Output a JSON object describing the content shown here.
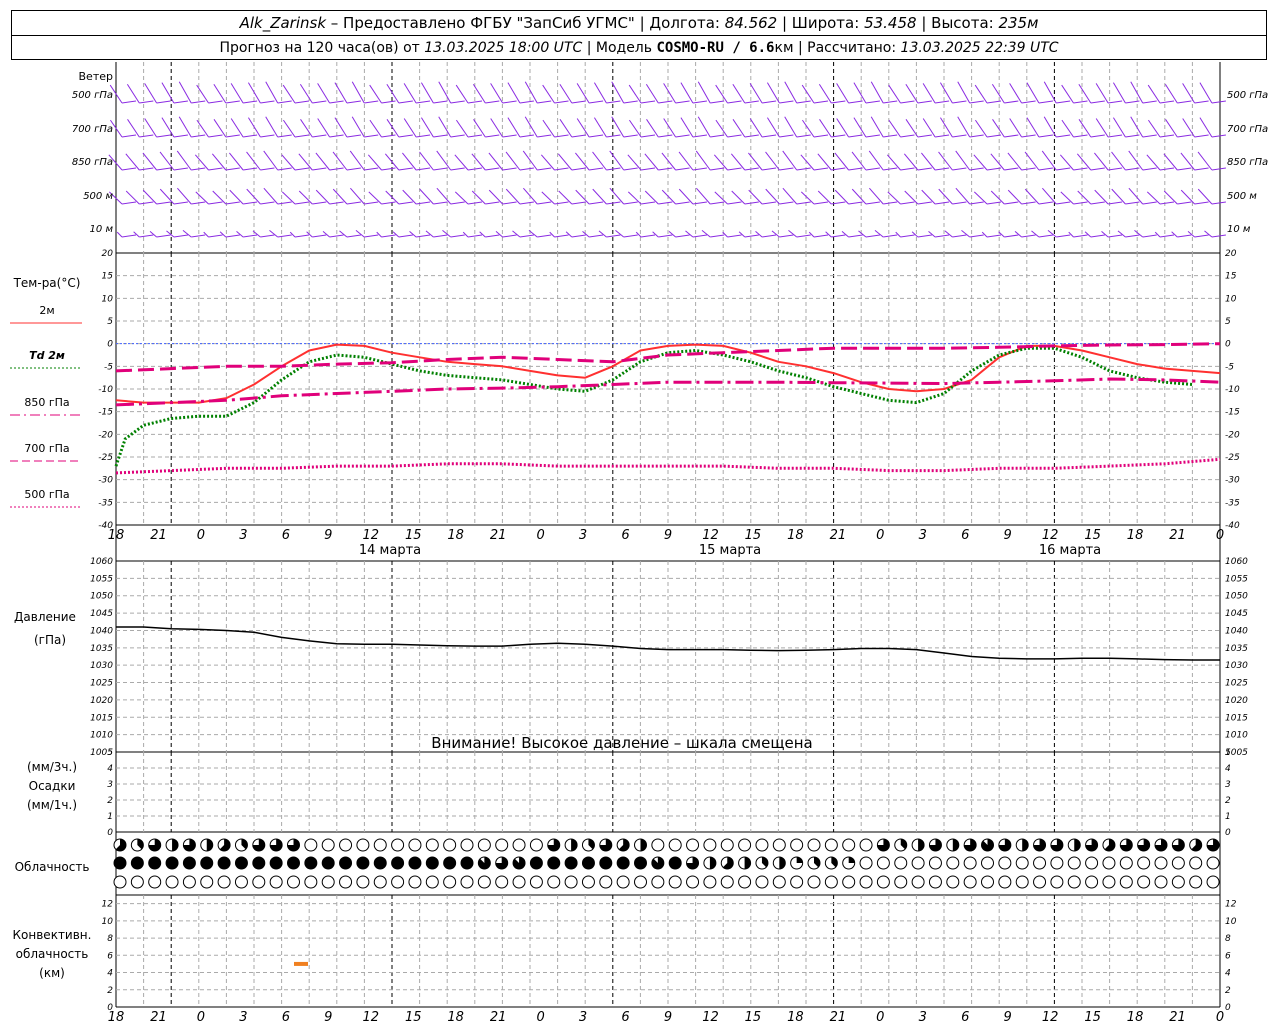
{
  "header": {
    "station": "Alk_Zarinsk",
    "provided": " – Предоставлено ФГБУ \"ЗапСиб УГМС\" | Долгота: ",
    "lon": "84.562",
    "lat_label": " | Широта: ",
    "lat": "53.458",
    "alt_label": " | Высота: ",
    "alt": "235м",
    "forecast_label": "Прогноз на 120 часа(ов) от ",
    "forecast_from": "13.03.2025 18:00 UTC",
    "model_label": " | Модель ",
    "model": "COSMO-RU / 6.6",
    "model_unit": "км",
    "calc_label": " | Рассчитано: ",
    "calc_time": "13.03.2025 22:39 UTC"
  },
  "x_ticks": [
    "18",
    "21",
    "0",
    "3",
    "6",
    "9",
    "12",
    "15",
    "18",
    "21",
    "0",
    "3",
    "6",
    "9",
    "12",
    "15",
    "18",
    "21",
    "0",
    "3",
    "6",
    "9",
    "12",
    "15",
    "18",
    "21",
    "0"
  ],
  "day_labels": [
    "14 марта",
    "15 марта",
    "16 марта"
  ],
  "wind_panel": {
    "title": "Ветер",
    "levels": [
      "500 гПа",
      "700 гПа",
      "850 гПа",
      "500 м",
      "10  м"
    ]
  },
  "temp_panel": {
    "title": "Тем-ра(°C)",
    "y_ticks": [
      20,
      15,
      10,
      5,
      0,
      -5,
      -10,
      -15,
      -20,
      -25,
      -30,
      -35,
      -40
    ],
    "legend": [
      {
        "label": "2м",
        "color": "#ff3030",
        "style": "solid"
      },
      {
        "label": "Td  2м",
        "color": "#008000",
        "style": "dotted"
      },
      {
        "label": "850 гПа",
        "color": "#e0007a",
        "style": "dashdot"
      },
      {
        "label": "700 гПа",
        "color": "#e0007a",
        "style": "dash"
      },
      {
        "label": "500 гПа",
        "color": "#e0007a",
        "style": "dotfine"
      }
    ]
  },
  "pressure_panel": {
    "title": "Давление",
    "unit": "(гПа)",
    "y_ticks": [
      1060,
      1055,
      1050,
      1045,
      1040,
      1035,
      1030,
      1025,
      1020,
      1015,
      1010,
      1005
    ],
    "warning": "Внимание! Высокое давление – шкала смещена"
  },
  "precip_panel": {
    "title_top": "(мм/3ч.)",
    "title_mid": "Осадки",
    "title_bot": "(мм/1ч.)",
    "y_ticks": [
      5,
      4,
      3,
      2,
      1,
      0
    ]
  },
  "cloud_panel": {
    "title": "Облачность"
  },
  "conv_panel": {
    "title1": "Конвективн.",
    "title2": "облачность",
    "title3": "(км)",
    "y_ticks": [
      12,
      10,
      8,
      6,
      4,
      2,
      0
    ],
    "color": "#f08020"
  },
  "chart_data": {
    "type": "line",
    "x_unit": "hours since 13.03.2025 18:00 UTC",
    "temperature": {
      "ylim": [
        -40,
        20
      ],
      "series": [
        {
          "name": "2м",
          "x": [
            0,
            3,
            6,
            9,
            12,
            15,
            18,
            21,
            24,
            27,
            30,
            33,
            36,
            39,
            42,
            45,
            48,
            51,
            54,
            57,
            60,
            63,
            66,
            69,
            72,
            75,
            78,
            81,
            84,
            87,
            90,
            93,
            96,
            99,
            102,
            105,
            108,
            111,
            114,
            117,
            120
          ],
          "values": [
            -12.5,
            -13,
            -13,
            -13,
            -12,
            -9,
            -5,
            -1.5,
            -0.2,
            -0.5,
            -2,
            -3,
            -4,
            -4.5,
            -5,
            -6,
            -7,
            -7.5,
            -5,
            -1.5,
            -0.5,
            -0.2,
            -0.5,
            -2,
            -4,
            -5,
            -6.5,
            -8.5,
            -10,
            -10.5,
            -10,
            -8,
            -3,
            -0.5,
            -0.5,
            -1.5,
            -3,
            -4.5,
            -5.5,
            -6,
            -6.5
          ]
        },
        {
          "name": "Td  2м",
          "x": [
            0,
            1,
            3,
            6,
            9,
            12,
            15,
            18,
            21,
            24,
            27,
            30,
            33,
            36,
            39,
            42,
            45,
            48,
            51,
            54,
            57,
            60,
            63,
            66,
            69,
            72,
            75,
            78,
            81,
            84,
            87,
            90,
            93,
            96,
            99,
            102,
            105,
            108,
            111,
            114,
            117,
            120
          ],
          "values": [
            -27,
            -21,
            -18,
            -16.5,
            -16,
            -16,
            -13,
            -8,
            -4,
            -2.5,
            -3,
            -4.5,
            -6,
            -7,
            -7.5,
            -8,
            -9,
            -10,
            -10.5,
            -8,
            -4,
            -2,
            -1.5,
            -2.5,
            -4,
            -6,
            -7.5,
            -9.5,
            -11,
            -12.5,
            -13,
            -11,
            -6,
            -2.5,
            -1,
            -1,
            -3,
            -6,
            -7.5,
            -8.5,
            -9
          ]
        },
        {
          "name": "850 гПа",
          "x": [
            0,
            6,
            12,
            18,
            24,
            30,
            36,
            42,
            48,
            54,
            60,
            66,
            72,
            78,
            84,
            90,
            96,
            102,
            108,
            114,
            120
          ],
          "values": [
            -13.5,
            -13,
            -12.5,
            -11.5,
            -11,
            -10.5,
            -10,
            -9.8,
            -9.5,
            -9,
            -8.5,
            -8.5,
            -8.5,
            -8.6,
            -8.7,
            -8.8,
            -8.5,
            -8.2,
            -7.8,
            -8,
            -8.5
          ]
        },
        {
          "name": "700 гПа",
          "x": [
            0,
            6,
            12,
            18,
            24,
            30,
            36,
            42,
            48,
            54,
            60,
            66,
            72,
            78,
            84,
            90,
            96,
            102,
            108,
            114,
            120
          ],
          "values": [
            -6,
            -5.5,
            -5,
            -5,
            -4.5,
            -4.2,
            -3.5,
            -3,
            -3.5,
            -4,
            -2.5,
            -2,
            -1.5,
            -1,
            -1,
            -1,
            -0.8,
            -0.5,
            -0.3,
            -0.2,
            0
          ]
        },
        {
          "name": "500 гПа",
          "x": [
            0,
            6,
            12,
            18,
            24,
            30,
            36,
            42,
            48,
            54,
            60,
            66,
            72,
            78,
            84,
            90,
            96,
            102,
            108,
            114,
            120
          ],
          "values": [
            -28.5,
            -28,
            -27.5,
            -27.5,
            -27,
            -27,
            -26.5,
            -26.5,
            -27,
            -27,
            -27,
            -27,
            -27.5,
            -27.5,
            -28,
            -28,
            -27.5,
            -27.5,
            -27,
            -26.5,
            -25.5
          ]
        }
      ]
    },
    "pressure": {
      "ylim": [
        1005,
        1060
      ],
      "series": [
        {
          "name": "Давление",
          "x": [
            0,
            3,
            6,
            9,
            12,
            15,
            18,
            21,
            24,
            27,
            30,
            33,
            36,
            39,
            42,
            45,
            48,
            51,
            54,
            57,
            60,
            63,
            66,
            69,
            72,
            75,
            78,
            81,
            84,
            87,
            90,
            93,
            96,
            99,
            102,
            105,
            108,
            111,
            114,
            117,
            120
          ],
          "values": [
            1041,
            1041,
            1040.5,
            1040.3,
            1040,
            1039.5,
            1038,
            1037,
            1036.2,
            1036,
            1036,
            1035.8,
            1035.6,
            1035.5,
            1035.5,
            1036,
            1036.3,
            1036,
            1035.5,
            1034.8,
            1034.5,
            1034.5,
            1034.5,
            1034.3,
            1034.2,
            1034.3,
            1034.5,
            1034.8,
            1034.8,
            1034.5,
            1033.5,
            1032.5,
            1032,
            1031.8,
            1031.8,
            1032,
            1032,
            1031.8,
            1031.6,
            1031.5,
            1031.5
          ]
        }
      ]
    },
    "precipitation": {
      "ylim": [
        0,
        5
      ],
      "values_mm_per_3h": []
    },
    "convective_cloud": {
      "ylim": [
        0,
        13
      ],
      "bars": [
        {
          "x": 20,
          "height_km": 5
        }
      ]
    },
    "cloud_cover_eighths": {
      "low": [
        0,
        0,
        0,
        0,
        0,
        0,
        0,
        0,
        0,
        0,
        0,
        0,
        0,
        0,
        0,
        0,
        0,
        0,
        0,
        0,
        0,
        0,
        0,
        0,
        0,
        0,
        0,
        0,
        0,
        0,
        0,
        0,
        0,
        0,
        0,
        0,
        0,
        0,
        0,
        0,
        0
      ],
      "mid": [
        8,
        8,
        8,
        8,
        8,
        8,
        8,
        8,
        8,
        8,
        8,
        8,
        8,
        8,
        8,
        8,
        8,
        8,
        8,
        8,
        8,
        7,
        6,
        7,
        8,
        8,
        8,
        8,
        8,
        8,
        8,
        7,
        8,
        6,
        4,
        5,
        4,
        3,
        4,
        2,
        3,
        3,
        2,
        0,
        0,
        0,
        0,
        0,
        0,
        0,
        0,
        0,
        0,
        0,
        0,
        0,
        0,
        0,
        0,
        0,
        0,
        0,
        0,
        0
      ],
      "high": [
        5,
        3,
        6,
        4,
        6,
        4,
        5,
        3,
        6,
        6,
        6,
        0,
        0,
        0,
        0,
        0,
        0,
        0,
        0,
        0,
        0,
        0,
        0,
        0,
        0,
        6,
        4,
        3,
        6,
        5,
        4,
        0,
        0,
        0,
        0,
        0,
        0,
        0,
        0,
        0,
        0,
        0,
        0,
        0,
        6,
        3,
        4,
        6,
        4,
        6,
        7,
        6,
        4,
        6,
        6,
        4,
        6,
        5,
        6,
        6,
        6,
        6,
        5,
        6,
        7,
        5,
        6,
        4,
        6,
        6,
        7,
        6,
        6,
        4,
        0,
        0,
        0,
        0,
        0,
        0,
        0,
        0,
        0,
        0,
        0,
        0,
        0,
        0,
        0,
        0,
        0,
        0,
        0,
        0,
        0,
        0,
        0,
        0,
        6,
        5,
        4,
        5,
        6,
        4,
        6,
        6,
        6,
        6,
        6
      ]
    },
    "wind": {
      "levels": [
        "500 гПа",
        "700 гПа",
        "850 гПа",
        "500 м",
        "10  м"
      ]
    }
  }
}
